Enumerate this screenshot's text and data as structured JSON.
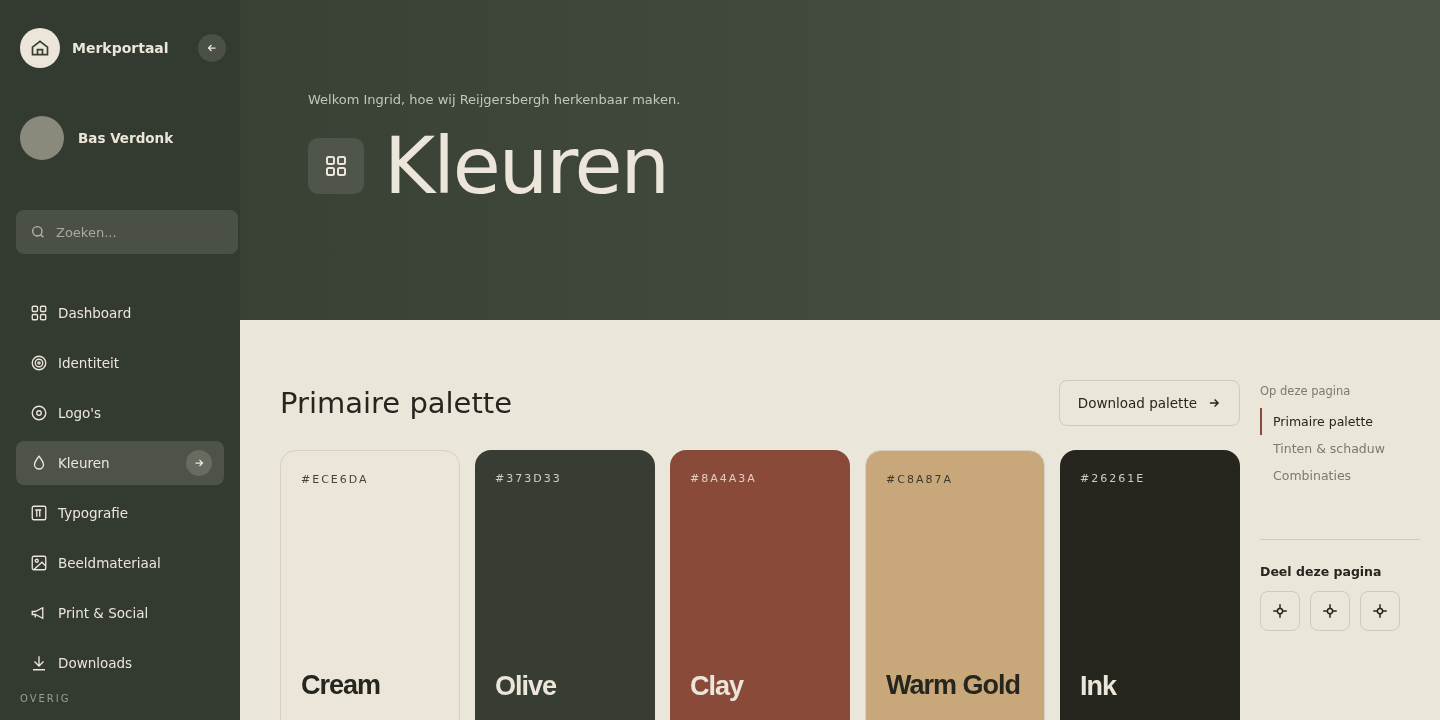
{
  "sidebar": {
    "brand": "Merkportaal",
    "user": "Bas Verdonk",
    "search": {
      "placeholder": "Zoeken..."
    },
    "items": [
      {
        "label": "Dashboard",
        "selected": false
      },
      {
        "label": "Identiteit",
        "selected": false
      },
      {
        "label": "Logo's",
        "selected": false
      },
      {
        "label": "Kleuren",
        "selected": true
      },
      {
        "label": "Typografie",
        "selected": false
      },
      {
        "label": "Beeldmateriaal",
        "selected": false
      },
      {
        "label": "Print & Social",
        "selected": false
      },
      {
        "label": "Downloads",
        "selected": false
      }
    ],
    "section": "OVERIG"
  },
  "hero": {
    "welcome": "Welkom Ingrid, hoe wij Reijgersbergh herkenbaar maken.",
    "title": "Kleuren"
  },
  "palette": {
    "heading": "Primaire palette",
    "download": "Download palette",
    "swatches": [
      {
        "hex": "#ECE6DA",
        "name": "Cream",
        "color": "#ece6da"
      },
      {
        "hex": "#373D33",
        "name": "Olive",
        "color": "#373d33"
      },
      {
        "hex": "#8A4A3A",
        "name": "Clay",
        "color": "#8a4a3a"
      },
      {
        "hex": "#C8A87A",
        "name": "Warm Gold",
        "color": "#c8a87a"
      },
      {
        "hex": "#26261E",
        "name": "Ink",
        "color": "#26261e"
      }
    ]
  },
  "toc": {
    "title": "Op deze pagina",
    "items": [
      {
        "label": "Primaire palette",
        "selected": true
      },
      {
        "label": "Tinten & schaduw",
        "selected": false
      },
      {
        "label": "Combinaties",
        "selected": false
      }
    ]
  },
  "share": {
    "title": "Deel deze pagina"
  }
}
